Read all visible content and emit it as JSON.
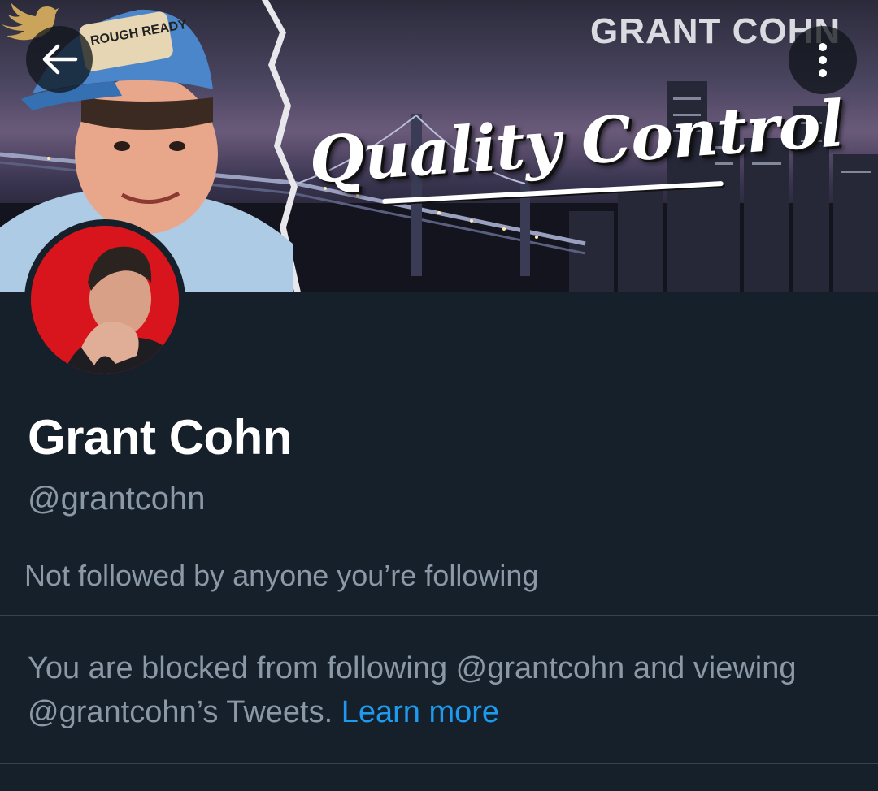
{
  "header": {
    "back_icon": "arrow-left-icon",
    "more_icon": "more-vertical-icon"
  },
  "banner": {
    "brand_name": "GRANT COHN",
    "brand_icon": "bird-icon",
    "title": "Quality Control",
    "cap_patch": "ROUGH READY",
    "accent_color": "#c9a45a"
  },
  "profile": {
    "display_name": "Grant Cohn",
    "handle": "@grantcohn",
    "followers_note": "Not followed by anyone you’re following",
    "avatar_bg_color": "#d8141c"
  },
  "blocked": {
    "message": "You are blocked from following @grantcohn and viewing @grantcohn’s Tweets.",
    "link_label": "Learn more",
    "link_color": "#1d9bf0"
  },
  "theme": {
    "background": "#15202b",
    "secondary_text": "#8b98a5",
    "divider": "#38444d"
  }
}
